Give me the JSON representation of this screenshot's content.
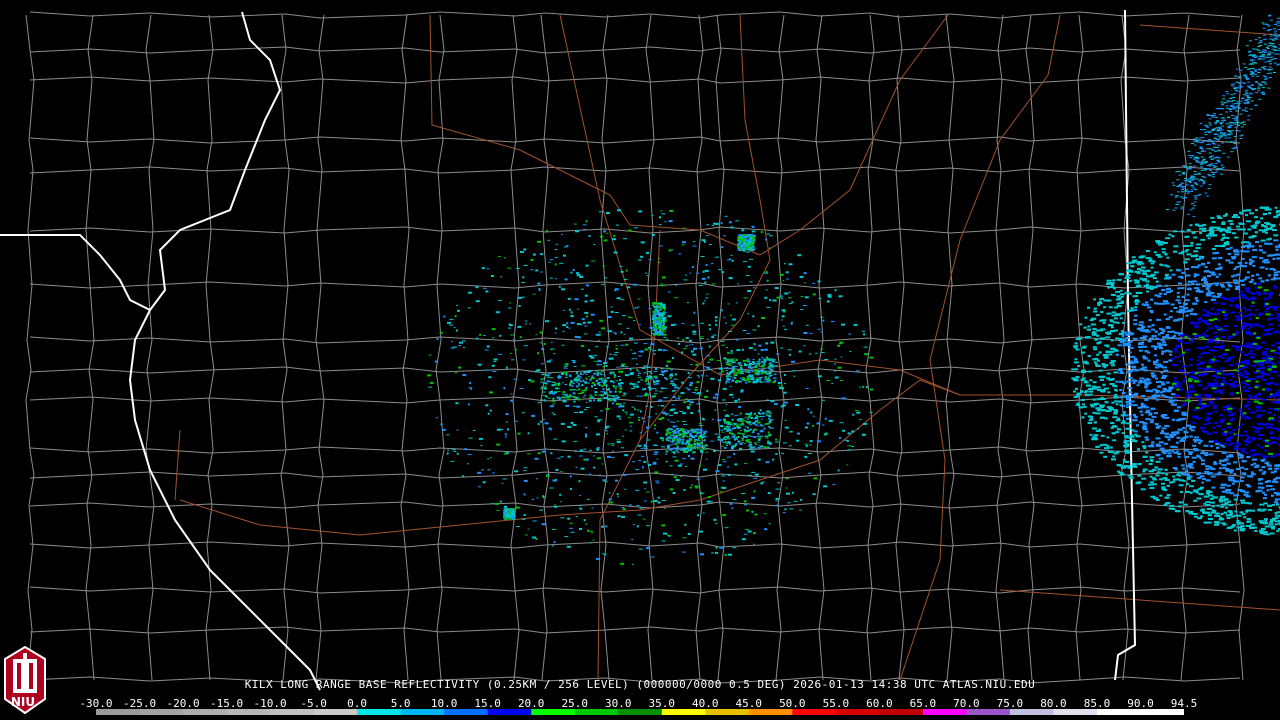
{
  "caption": "KILX LONG RANGE BASE REFLECTIVITY (0.25KM / 256 LEVEL) (000000/0000 0.5 DEG) 2026-01-13 14:38 UTC  ATLAS.NIU.EDU",
  "logo_text": "NIU",
  "scale": {
    "labels": [
      "-30.0",
      "-25.0",
      "-20.0",
      "-15.0",
      "-10.0",
      "-5.0",
      "0.0",
      "5.0",
      "10.0",
      "15.0",
      "20.0",
      "25.0",
      "30.0",
      "35.0",
      "40.0",
      "45.0",
      "50.0",
      "55.0",
      "60.0",
      "65.0",
      "70.0",
      "75.0",
      "80.0",
      "85.0",
      "90.0",
      "94.5"
    ],
    "colors": [
      "#9a9a9a",
      "#a3a3a3",
      "#adadad",
      "#b6b6b6",
      "#c0c0c0",
      "#cacaca",
      "#00e5e5",
      "#00b4f0",
      "#0070ff",
      "#0000f0",
      "#00ff00",
      "#00c800",
      "#009000",
      "#ffff00",
      "#e7c000",
      "#ff9000",
      "#ff0000",
      "#d60000",
      "#c00000",
      "#ff00ff",
      "#9955c9",
      "#c0c0e0",
      "#e0e0f0",
      "#ffffff",
      "#ffffff"
    ]
  },
  "colors": {
    "background": "#000000",
    "county_lines": "#8c8c8c",
    "state_lines": "#ffffff",
    "roads": "#a0522d",
    "echo_light": "#00c8d0",
    "echo_mid": "#1e90ff",
    "echo_blue": "#0000e0",
    "echo_green": "#00c000"
  }
}
